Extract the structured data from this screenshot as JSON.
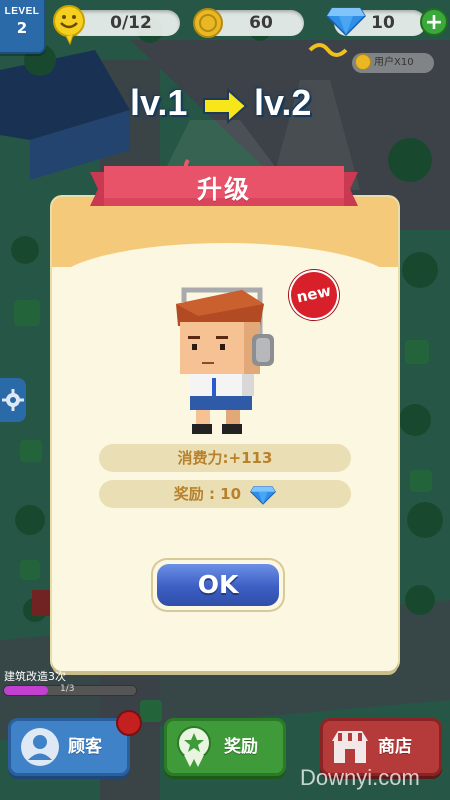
{
  "topbar": {
    "level_label": "LEVEL",
    "level_value": "2",
    "customers_count": "0/12",
    "coins": "60",
    "gems": "10",
    "add_label": "+"
  },
  "mini_reward": "用户X10",
  "levelup": {
    "from": "lv.1",
    "to": "lv.2"
  },
  "modal": {
    "title": "升级",
    "new_badge": "new",
    "spending_power": "消费力:+113",
    "reward_label": "奖励 : 10",
    "ok_label": "OK"
  },
  "progress": {
    "label": "建筑改造3次",
    "fraction": 0.33,
    "count_text": "1/3"
  },
  "bottom_nav": {
    "customers": "顾客",
    "rewards": "奖励",
    "shop": "商店"
  },
  "watermark": "Downyi.com",
  "colors": {
    "ribbon": "#e8536a",
    "modal_bg": "#fbf7e0",
    "ok_button": "#3d5fc4",
    "gem": "#2f8fe8",
    "level_badge": "#2a6aa8"
  }
}
